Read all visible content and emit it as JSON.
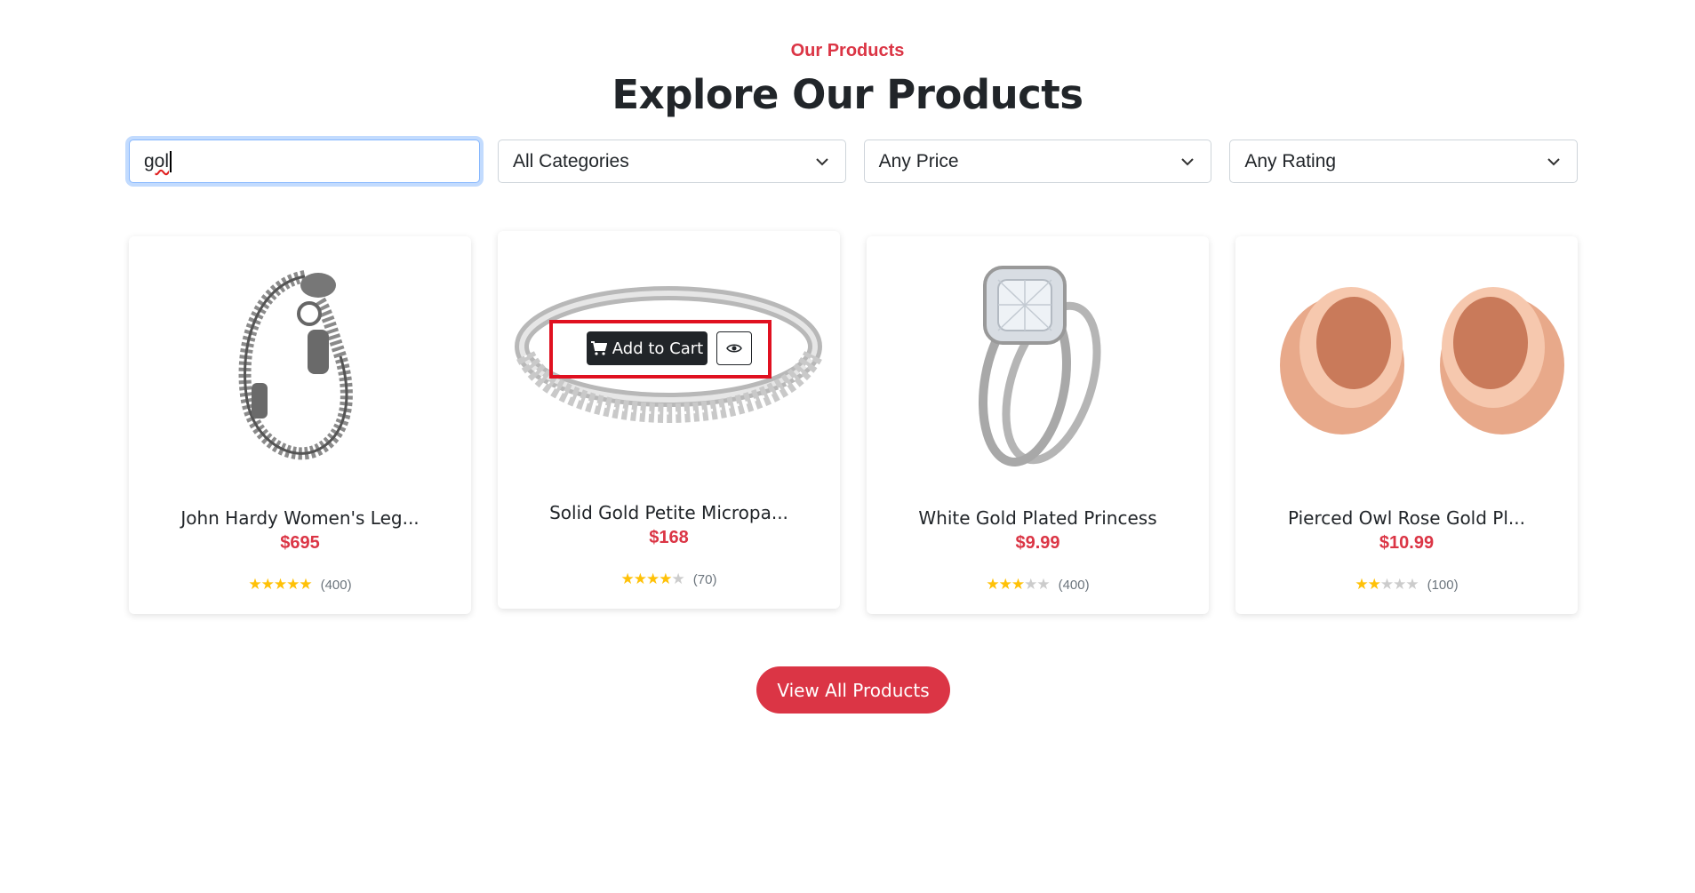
{
  "section": {
    "eyebrow": "Our Products",
    "title": "Explore Our Products"
  },
  "filters": {
    "search_value": "gol",
    "category": "All Categories",
    "price": "Any Price",
    "rating": "Any Rating"
  },
  "products": [
    {
      "name": "John Hardy Women's Leg...",
      "price": "$695",
      "rating": 5,
      "count": "(400)",
      "image": "silver-dragon-bracelet"
    },
    {
      "name": "Solid Gold Petite Micropa...",
      "price": "$168",
      "rating": 4,
      "count": "(70)",
      "image": "silver-pave-ring"
    },
    {
      "name": "White Gold Plated Princess",
      "price": "$9.99",
      "rating": 3,
      "count": "(400)",
      "image": "diamond-engagement-ring-set"
    },
    {
      "name": "Pierced Owl Rose Gold Pl...",
      "price": "$10.99",
      "rating": 2,
      "count": "(100)",
      "image": "rose-gold-plugs"
    }
  ],
  "hover_actions": {
    "add_to_cart": "Add to Cart",
    "cart_icon": "cart-icon",
    "quick_view_icon": "eye-icon"
  },
  "view_all": "View All Products",
  "colors": {
    "accent": "#db3545",
    "star": "#ffc107",
    "dark_button": "#212529"
  }
}
